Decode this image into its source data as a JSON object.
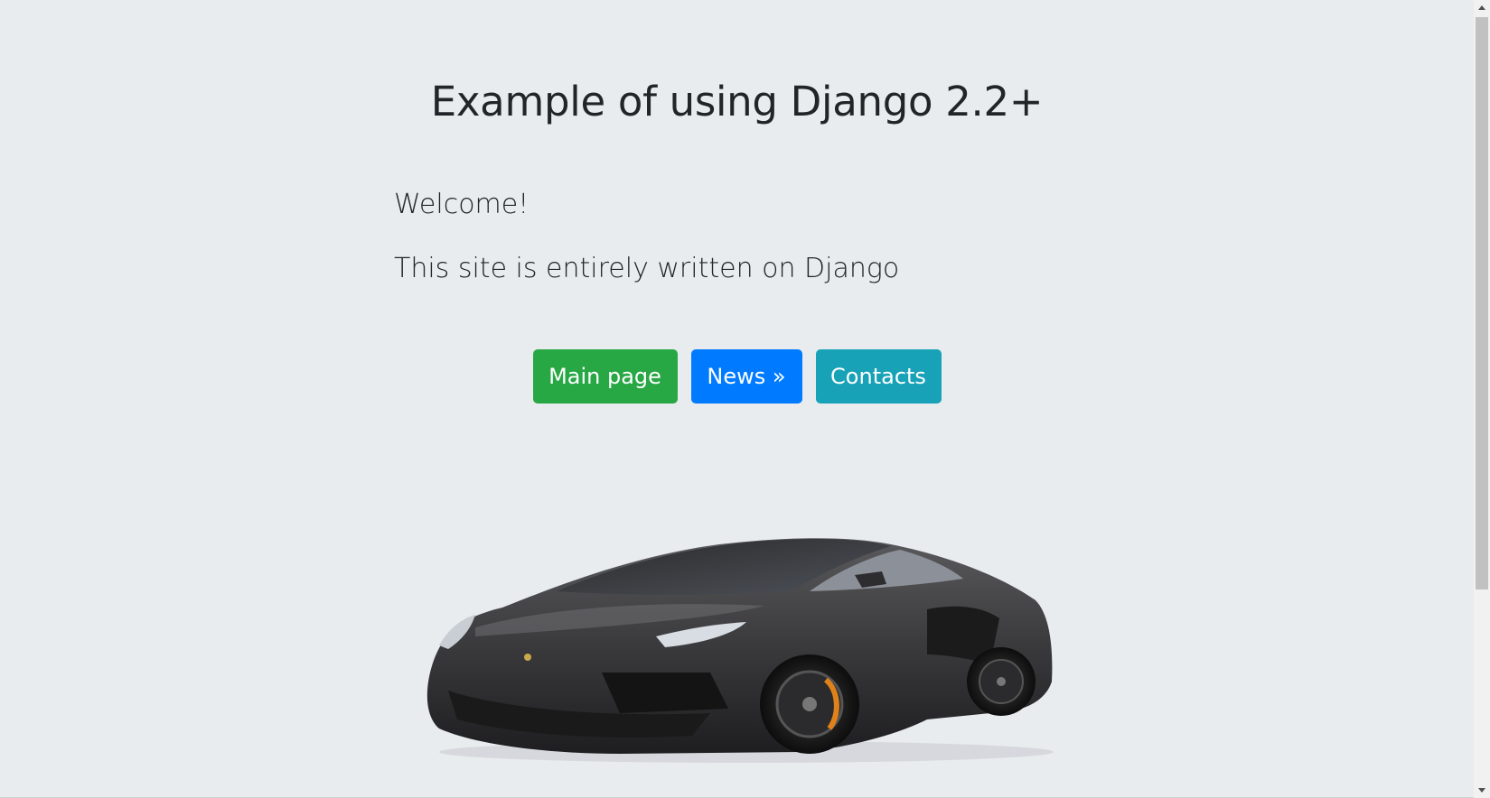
{
  "page": {
    "title": "Example of using Django 2.2+",
    "welcome": "Welcome!",
    "subtitle": "This site is entirely written on Django"
  },
  "buttons": {
    "main_page": "Main page",
    "news": "News »",
    "contacts": "Contacts"
  },
  "colors": {
    "background": "#e9ecef",
    "main_page_button": "#28a745",
    "news_button": "#007bff",
    "contacts_button": "#17a2b8"
  },
  "icons": {
    "hero_image": "sports-car-image",
    "scroll_up": "triangle-up-icon",
    "scroll_down": "triangle-down-icon"
  }
}
